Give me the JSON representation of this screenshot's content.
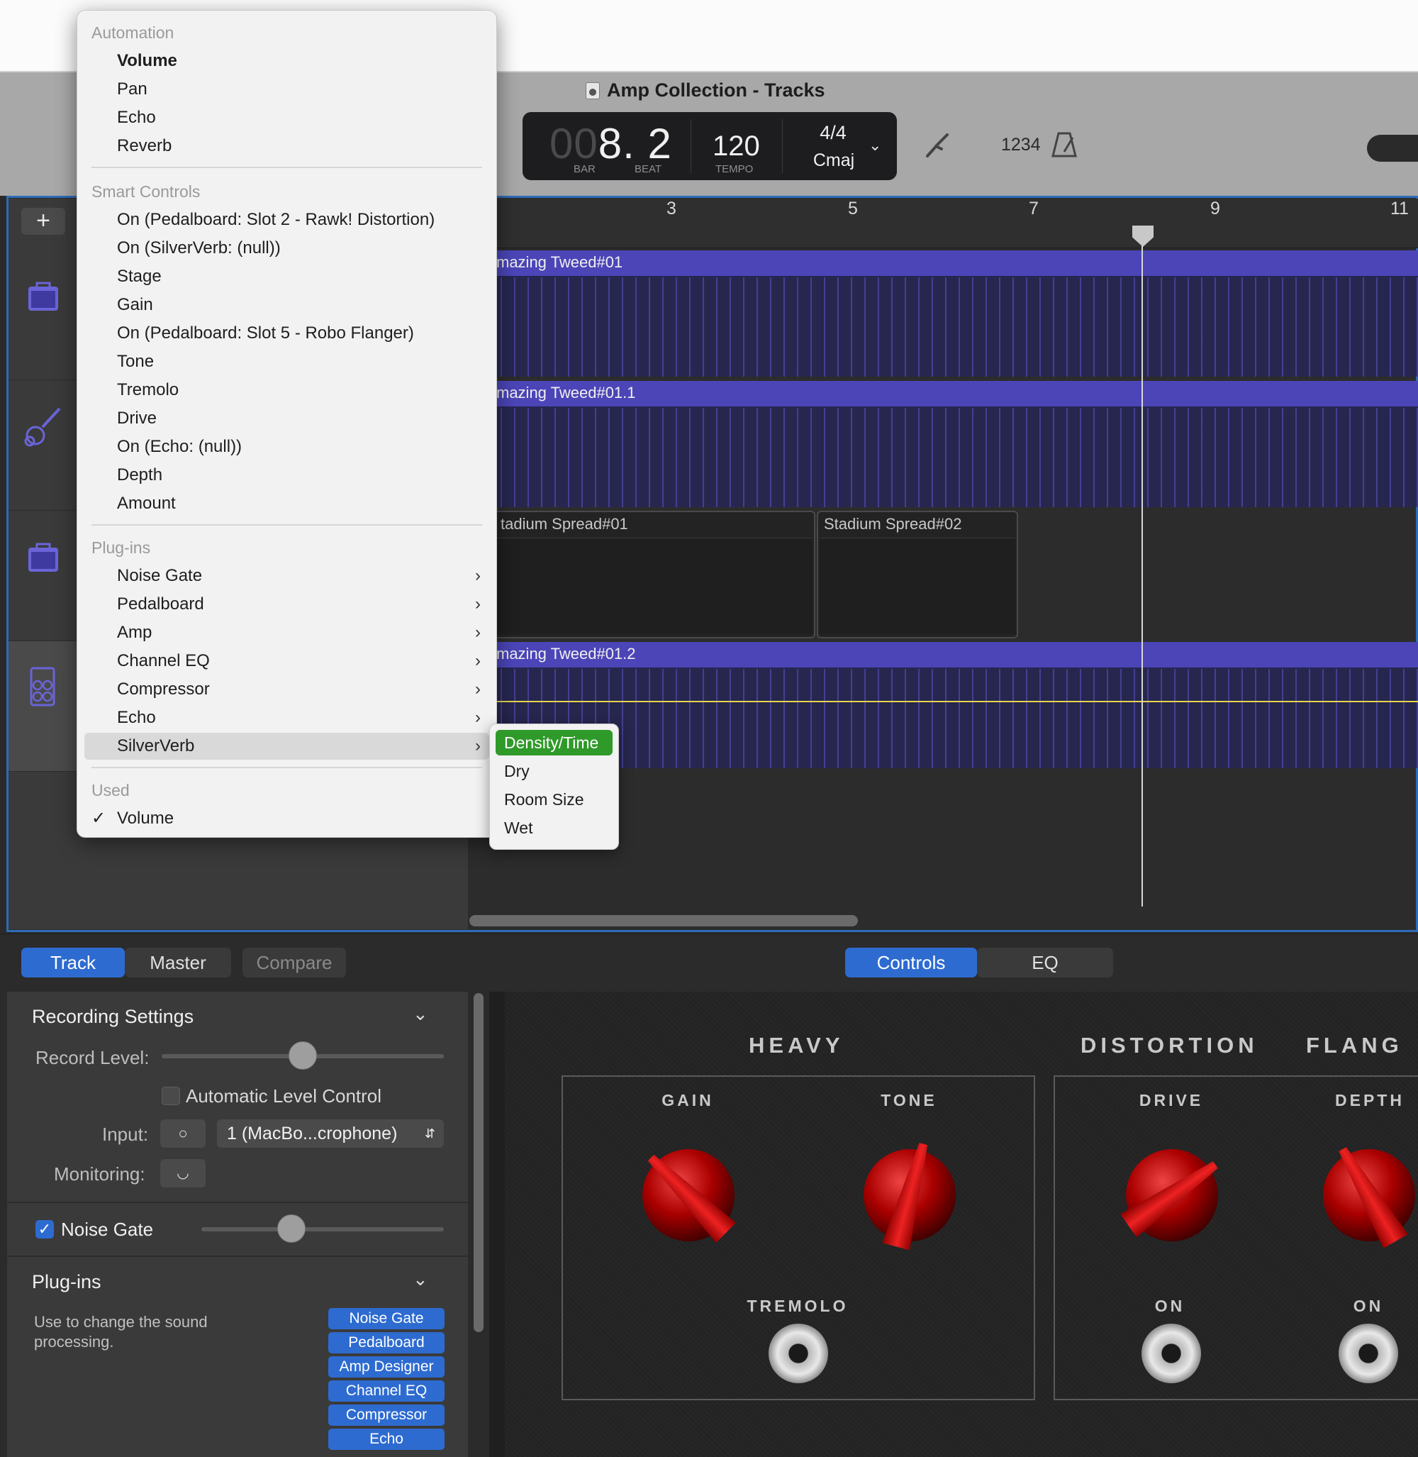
{
  "window": {
    "title": "Amp Collection - Tracks"
  },
  "lcd": {
    "position_dim": "00",
    "position_bar": "8",
    "position_beat": ". 2",
    "bar_label": "BAR",
    "beat_label": "BEAT",
    "tempo": "120",
    "tempo_label": "TEMPO",
    "time_signature": "4/4",
    "key": "Cmaj"
  },
  "toolbar": {
    "count_in": "1234"
  },
  "ruler": {
    "bars": [
      "3",
      "5",
      "7",
      "9",
      "11"
    ]
  },
  "regions": {
    "r1": "mazing Tweed#01",
    "r2": "mazing Tweed#01.1",
    "r3a": "tadium Spread#01",
    "r3b": "Stadium Spread#02",
    "r4": "mazing Tweed#01.2"
  },
  "menu": {
    "automation_header": "Automation",
    "automation": [
      "Volume",
      "Pan",
      "Echo",
      "Reverb"
    ],
    "smart_header": "Smart Controls",
    "smart": [
      "On (Pedalboard: Slot 2 - Rawk! Distortion)",
      "On (SilverVerb: (null))",
      "Stage",
      "Gain",
      "On (Pedalboard: Slot 5 - Robo Flanger)",
      "Tone",
      "Tremolo",
      "Drive",
      "On (Echo: (null))",
      "Depth",
      "Amount"
    ],
    "plugins_header": "Plug-ins",
    "plugins": [
      "Noise Gate",
      "Pedalboard",
      "Amp",
      "Channel EQ",
      "Compressor",
      "Echo",
      "SilverVerb"
    ],
    "used_header": "Used",
    "used_item": "Volume",
    "used_check": "✓"
  },
  "submenu": {
    "items": [
      "Density/Time",
      "Dry",
      "Room Size",
      "Wet"
    ]
  },
  "bottom_tabs": {
    "track": "Track",
    "master": "Master",
    "compare": "Compare",
    "controls": "Controls",
    "eq": "EQ"
  },
  "inspector": {
    "recording_settings": "Recording Settings",
    "record_level_label": "Record Level:",
    "record_level": 0.5,
    "auto_level": "Automatic Level Control",
    "auto_level_checked": false,
    "input_label": "Input:",
    "input_value": "1  (MacBo...crophone)",
    "monitoring_label": "Monitoring:",
    "noise_gate": "Noise Gate",
    "noise_gate_checked": true,
    "noise_gate_level": 0.37,
    "plugins_title": "Plug-ins",
    "plugins_desc": "Use to change the sound processing.",
    "plugin_buttons": [
      "Noise Gate",
      "Pedalboard",
      "Amp Designer",
      "Channel EQ",
      "Compressor",
      "Echo"
    ]
  },
  "smart_controls": {
    "heavy": "HEAVY",
    "distortion": "DISTORTION",
    "flanger": "FLANG",
    "gain": "GAIN",
    "tone": "TONE",
    "tremolo": "TREMOLO",
    "drive": "DRIVE",
    "depth": "DEPTH",
    "on1": "ON",
    "on2": "ON"
  },
  "colors": {
    "accent": "#2d6bd0",
    "region": "#4b45b8",
    "submenu_highlight": "#2f9a2a",
    "knob": "#c01010"
  }
}
